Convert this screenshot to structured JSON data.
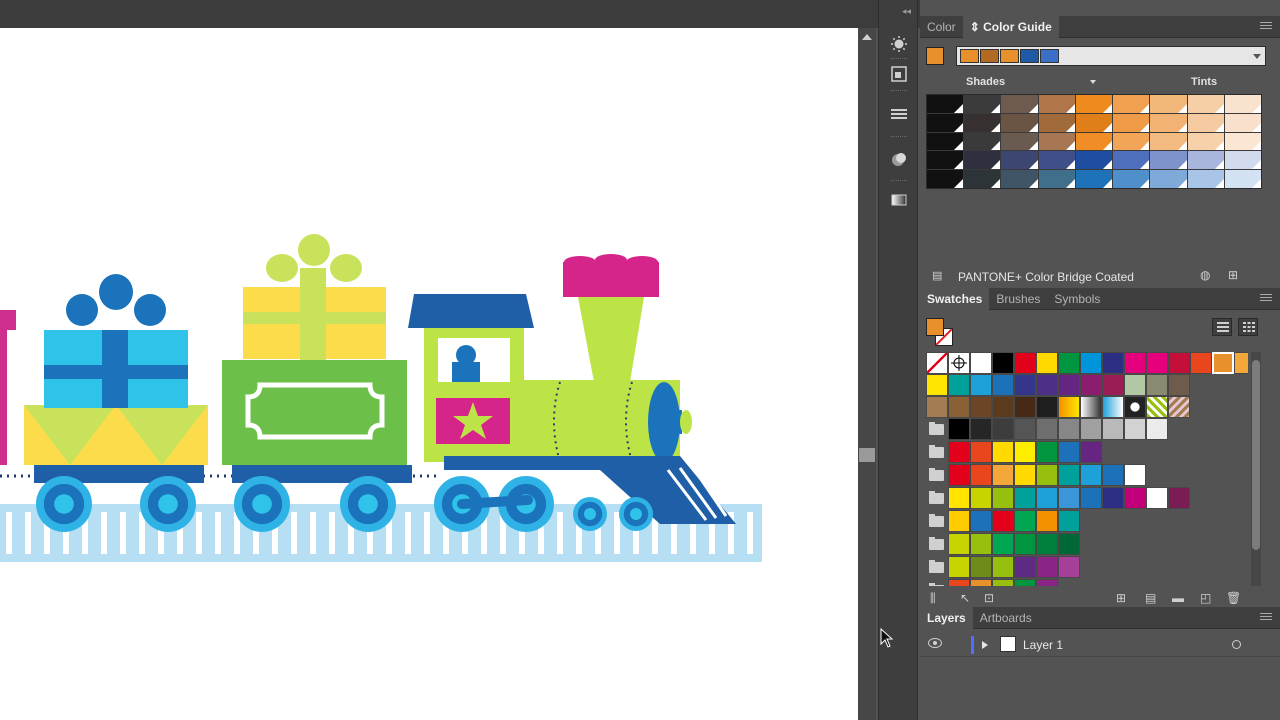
{
  "colors": {
    "accent_fill": "#e8902c"
  },
  "color_panel": {
    "tabs": [
      {
        "label": "Color",
        "active": false
      },
      {
        "label": "Color Guide",
        "active": true
      }
    ],
    "harmony_colors": [
      "#e8902c",
      "#b06a22",
      "#e8902c",
      "#1f5aa6",
      "#3a6fc8"
    ],
    "shades_label": "Shades",
    "tints_label": "Tints",
    "guide_rows": [
      [
        "#111111",
        "#3b3b3b",
        "#6e5a4e",
        "#b0764a",
        "#ef8a1e",
        "#f0a050",
        "#f3b879",
        "#f6cfa6",
        "#f9e3cf"
      ],
      [
        "#111111",
        "#363030",
        "#6a5444",
        "#a06a3a",
        "#e07f1a",
        "#ee9a46",
        "#f2b274",
        "#f5caa0",
        "#f9e0cc"
      ],
      [
        "#111111",
        "#3a3a3a",
        "#6a5b50",
        "#a77652",
        "#f08d26",
        "#f2a457",
        "#f4bb80",
        "#f7d1a9",
        "#fae6d3"
      ],
      [
        "#111111",
        "#2e3040",
        "#3c4670",
        "#3f4f8a",
        "#1f4ea0",
        "#4e6fbb",
        "#7e93cc",
        "#a8b6dd",
        "#d2dbee"
      ],
      [
        "#111111",
        "#2c3438",
        "#3f5566",
        "#3f6f8a",
        "#1e73b8",
        "#4f8fcc",
        "#7ea9d9",
        "#a8c4e6",
        "#d3e2f2"
      ]
    ],
    "library_name": "PANTONE+ Color Bridge Coated"
  },
  "swatches_panel": {
    "tabs": [
      {
        "label": "Swatches",
        "active": true
      },
      {
        "label": "Brushes",
        "active": false
      },
      {
        "label": "Symbols",
        "active": false
      }
    ],
    "rows": [
      [
        "none",
        "reg",
        "#ffffff",
        "#000000",
        "#e2001a",
        "#ffd900",
        "#009640",
        "#0095db",
        "#2b2e83",
        "#e5007d",
        "#e6007e",
        "#c40f3b",
        "#e9461d",
        "#e8902c",
        "#f4a83a"
      ],
      [
        "#ffe500",
        "#00a19a",
        "#1ea1d8",
        "#1d71b8",
        "#36358c",
        "#4e2f86",
        "#662483",
        "#8b1d6e",
        "#9b1d55",
        "#b2c7a4",
        "#8a8a73",
        "#6f5b4b"
      ],
      [
        "#a57c52",
        "#8a6036",
        "#6b4526",
        "#5c3a1e",
        "#472a16",
        "#1e1e1e",
        "grad1",
        "grad2",
        "grad3",
        "pat1",
        "pat2",
        "pat3"
      ],
      [
        "folder",
        "#000000",
        "#262626",
        "#3d3d3d",
        "#555555",
        "#6e6e6e",
        "#878787",
        "#a0a0a0",
        "#b9b9b9",
        "#d2d2d2",
        "#ebebeb"
      ],
      [
        "folder",
        "#e2001a",
        "#e9461d",
        "#ffd900",
        "#ffed00",
        "#009640",
        "#1d71b8",
        "#662483"
      ],
      [
        "folder",
        "#e2001a",
        "#e9461d",
        "#f4a83a",
        "#ffd900",
        "#97bf0d",
        "#00a19a",
        "#1ea1d8",
        "#1d71b8",
        "#ffffff"
      ],
      [
        "folder",
        "#ffe500",
        "#c8d400",
        "#97bf0d",
        "#00a19a",
        "#1ea1d8",
        "#3a96d8",
        "#1d71b8",
        "#2b2e83",
        "#c2007a",
        "#ffffff",
        "#7b1d55"
      ],
      [
        "folder",
        "#ffcc00",
        "#1d71b8",
        "#e2001a",
        "#00a651",
        "#f39200",
        "#00a19a"
      ],
      [
        "folder",
        "#c8d400",
        "#97bf0d",
        "#00a651",
        "#009640",
        "#007f3d",
        "#006837"
      ],
      [
        "folder",
        "#c8d400",
        "#6e8c1a",
        "#97bf0d",
        "#5e2a84",
        "#8b2585",
        "#a63f98"
      ],
      [
        "folder",
        "#e9461d",
        "#e8902c",
        "#97bf0d",
        "#009640",
        "#8b2585"
      ]
    ]
  },
  "layers_panel": {
    "tabs": [
      {
        "label": "Layers",
        "active": true
      },
      {
        "label": "Artboards",
        "active": false
      }
    ],
    "layer_name": "Layer 1",
    "layer_color": "#4f6fff"
  },
  "toolstrip": {
    "icons": [
      "sun-icon",
      "transform-icon",
      "align-icon",
      "appearance-icon",
      "gradient-icon"
    ]
  }
}
